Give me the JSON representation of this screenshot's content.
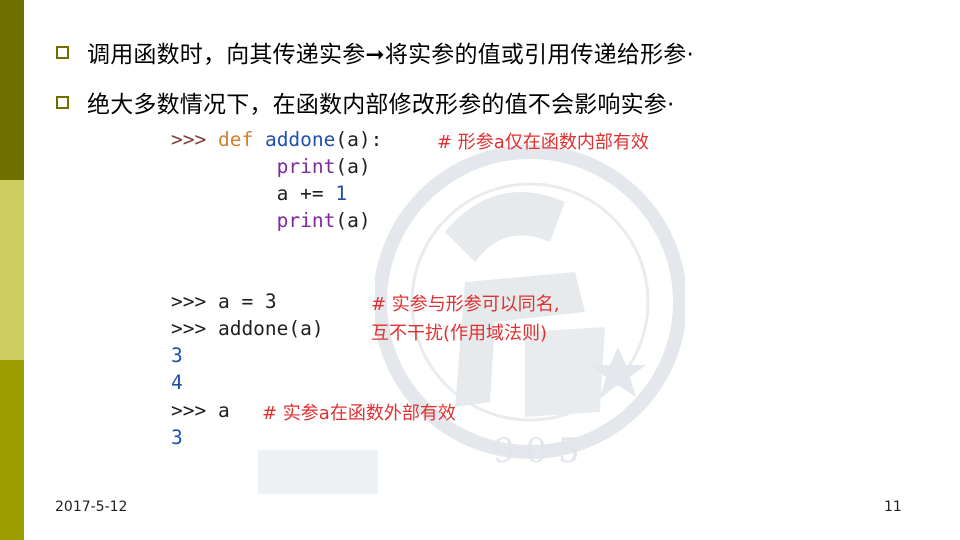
{
  "bullets": [
    "调用函数时，向其传递实参➞将实参的值或引用传递给形参·",
    "绝大多数情况下，在函数内部修改形参的值不会影响实参·"
  ],
  "code_block_1": {
    "line1_prompt": ">>> ",
    "line1_def": "def",
    "line1_name": "addone",
    "line1_rest": "(a):",
    "line2_print": "print",
    "line2_args": "(a)",
    "line3_code": "a += ",
    "line3_num": "1",
    "line4_print": "print",
    "line4_args": "(a)",
    "comment": "# 形参a仅在函数内部有效"
  },
  "code_block_2": {
    "line1": ">>> a = 3",
    "line2": ">>> addone(a)",
    "out1": "3",
    "out2": "4",
    "line5": ">>> a",
    "out3": "3",
    "comment1_line1": "# 实参与形参可以同名,",
    "comment1_line2": "互不干扰(作用域法则)",
    "comment2": "# 实参a在函数外部有效"
  },
  "footer": {
    "date": "2017-5-12",
    "page": "11"
  },
  "watermark_digits": "1905",
  "colors": {
    "sidebar_top": "#6f6f00",
    "sidebar_mid": "#cccc5f",
    "sidebar_bottom": "#9d9d00",
    "comment": "#e03030",
    "keyword": "#d17f2d",
    "function": "#1f4fb0",
    "builtin": "#7d2a9a"
  }
}
